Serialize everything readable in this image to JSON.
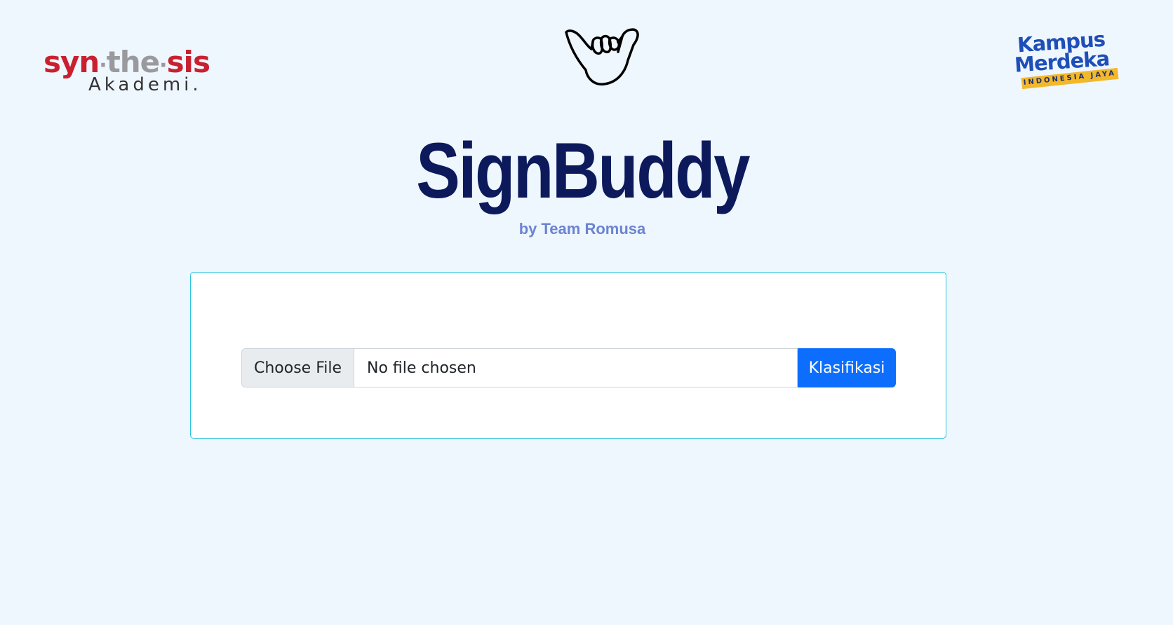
{
  "logos": {
    "left": {
      "syn": "syn",
      "the": "the",
      "sis": "sis",
      "separator": "·",
      "sub": "Akademi."
    },
    "center_icon": "shaka-hand-icon",
    "right": {
      "line1": "Kampus",
      "line2": "Merdeka",
      "ribbon": "INDONESIA JAYA"
    }
  },
  "header": {
    "title": "SignBuddy",
    "subtitle": "by Team Romusa"
  },
  "upload_form": {
    "choose_file_label": "Choose File",
    "file_status": "No file chosen",
    "submit_label": "Klasifikasi"
  },
  "colors": {
    "background": "#eef6fe",
    "title": "#0c1a5c",
    "subtitle": "#6b84d2",
    "card_border": "#28c4dd",
    "primary_button": "#0d6efd",
    "brand_red": "#c8202f",
    "brand_blue": "#1e4fb8"
  }
}
